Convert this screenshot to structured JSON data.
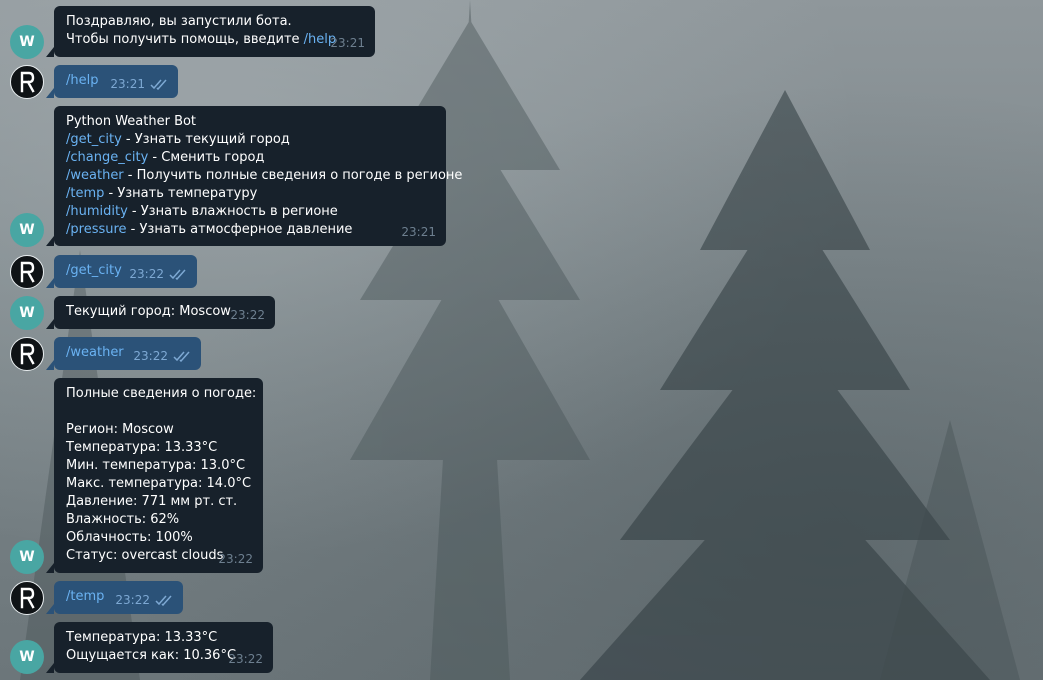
{
  "messages": [
    {
      "type": "bot",
      "lines": [
        {
          "text": "Поздравляю, вы запустили бота."
        },
        {
          "text": "Чтобы получить помощь, введите ",
          "cmd": "/help"
        }
      ],
      "time": "23:21"
    },
    {
      "type": "user",
      "text": "/help",
      "time": "23:21"
    },
    {
      "type": "bot",
      "lines": [
        {
          "text": "Python Weather Bot"
        },
        {
          "cmd": "/get_city",
          "text": " - Узнать текущий город"
        },
        {
          "cmd": "/change_city",
          "text": " - Сменить город"
        },
        {
          "cmd": "/weather",
          "text": " - Получить полные сведения о погоде в регионе"
        },
        {
          "cmd": "/temp",
          "text": " - Узнать температуру"
        },
        {
          "cmd": "/humidity",
          "text": " - Узнать влажность в регионе"
        },
        {
          "cmd": "/pressure",
          "text": " - Узнать атмосферное давление"
        }
      ],
      "time": "23:21"
    },
    {
      "type": "user",
      "text": "/get_city",
      "time": "23:22"
    },
    {
      "type": "bot",
      "lines": [
        {
          "text": "Текущий город: Moscow"
        }
      ],
      "time": "23:22"
    },
    {
      "type": "user",
      "text": "/weather",
      "time": "23:22"
    },
    {
      "type": "bot",
      "lines": [
        {
          "text": "Полные сведения о погоде:"
        },
        {
          "text": ""
        },
        {
          "text": "Регион: Moscow"
        },
        {
          "text": "Температура: 13.33°C"
        },
        {
          "text": "Мин. температура: 13.0°C"
        },
        {
          "text": "Макс. температура: 14.0°C"
        },
        {
          "text": "Давление: 771 мм рт. ст."
        },
        {
          "text": "Влажность: 62%"
        },
        {
          "text": "Облачность: 100%"
        },
        {
          "text": "Статус: overcast clouds"
        }
      ],
      "time": "23:22"
    },
    {
      "type": "user",
      "text": "/temp",
      "time": "23:22"
    },
    {
      "type": "bot",
      "lines": [
        {
          "text": "Температура: 13.33°C"
        },
        {
          "text": "Ощущается как: 10.36°C"
        }
      ],
      "time": "23:22"
    }
  ],
  "avatars": {
    "bot_letter": "W",
    "user_icon": "r-logo-icon"
  },
  "colors": {
    "bot_bubble": "#17212b",
    "user_bubble": "#2b5278",
    "command_link": "#6ab2f2",
    "bot_avatar": "#49a6a3",
    "read_checkmarks": "#7da8d3"
  }
}
